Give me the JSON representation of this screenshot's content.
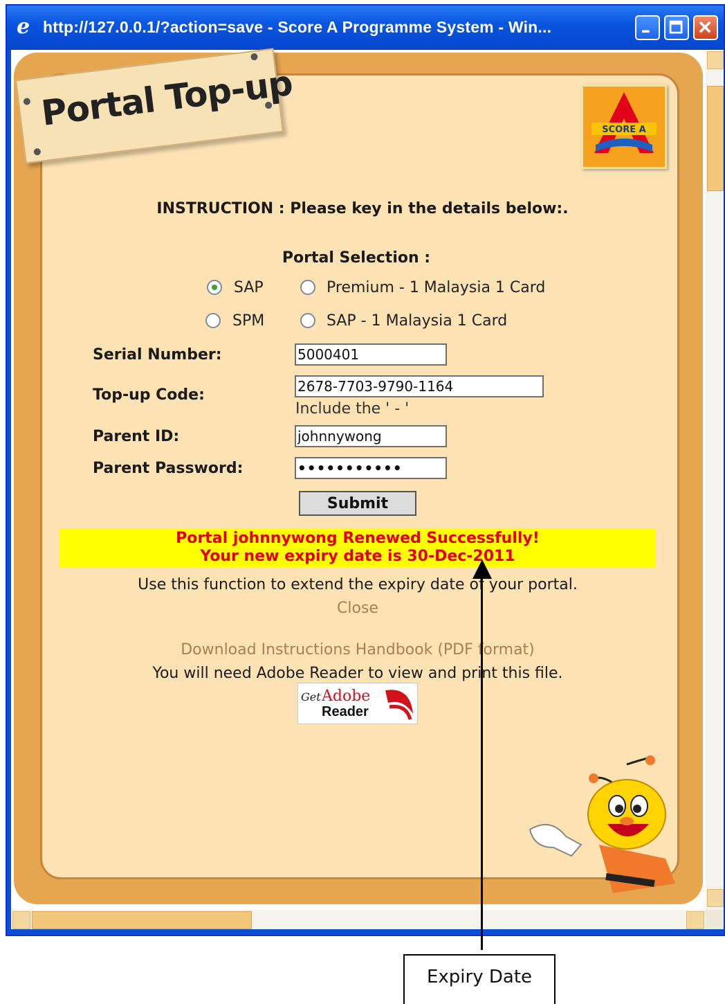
{
  "window": {
    "title": "http://127.0.0.1/?action=save - Score A Programme System - Win...",
    "buttons": [
      "minimize",
      "maximize",
      "close"
    ]
  },
  "page": {
    "heading": "Portal Top-up",
    "logo_text": "SCORE A",
    "instruction": "INSTRUCTION : Please key in the details below:.",
    "portal_selection_label": "Portal Selection :",
    "portal_options": [
      {
        "label": "SAP",
        "checked": true
      },
      {
        "label": "Premium - 1 Malaysia 1 Card",
        "checked": false
      },
      {
        "label": "SPM",
        "checked": false
      },
      {
        "label": "SAP - 1 Malaysia 1 Card",
        "checked": false
      }
    ],
    "form": {
      "serial_label": "Serial Number:",
      "serial_value": "5000401",
      "topup_label": "Top-up Code:",
      "topup_value": "2678-7703-9790-1164",
      "topup_hint": "Include the ' - '",
      "parent_id_label": "Parent ID:",
      "parent_id_value": "johnnywong",
      "password_label": "Parent Password:",
      "password_value": "•••••••••••",
      "submit_label": "Submit"
    },
    "success": {
      "line1": "Portal johnnywong Renewed Successfully!",
      "line2": "Your new expiry date is 30-Dec-2011"
    },
    "extend_text": "Use this function to extend the expiry date of your portal.",
    "close_link": "Close",
    "download_link": "Download Instructions Handbook (PDF format)",
    "adobe_note": "You will need Adobe Reader to view and print this file.",
    "adobe_badge": {
      "get": "Get",
      "brand": "Adobe",
      "product": "Reader"
    }
  },
  "annotation": {
    "label": "Expiry Date"
  },
  "colors": {
    "titlebar": "#0a55e0",
    "frame": "#e6a64f",
    "panel": "#fde3b4",
    "banner_bg": "#ffff00",
    "banner_text": "#e2001a",
    "link": "#a8804f"
  }
}
